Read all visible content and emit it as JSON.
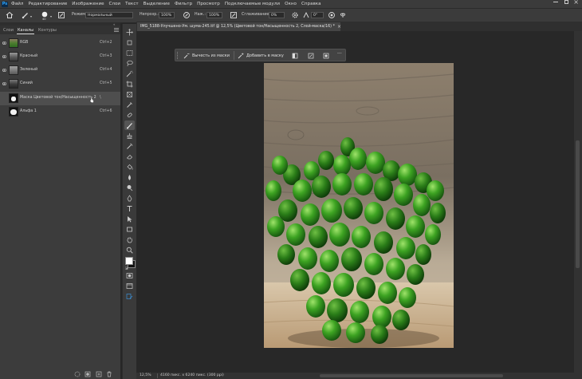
{
  "menubar": {
    "logo": "Ps",
    "items": [
      "Файл",
      "Редактирование",
      "Изображение",
      "Слои",
      "Текст",
      "Выделение",
      "Фильтр",
      "Просмотр",
      "Подключаемые модули",
      "Окно",
      "Справка"
    ]
  },
  "options": {
    "brush_size": "40",
    "mode_label": "Режим:",
    "mode_value": "Нормальный",
    "opacity_label": "Непрозр.:",
    "opacity_value": "100%",
    "flow_label": "Наж.:",
    "flow_value": "100%",
    "smoothing_label": "Сглаживание:",
    "smoothing_value": "0%",
    "angle_value": "0°"
  },
  "panel": {
    "tabs": [
      "Слои",
      "Каналы",
      "Контуры"
    ],
    "active_tab": "Каналы",
    "channels": [
      {
        "name": "RGB",
        "shortcut": "Ctrl+2",
        "visible": true,
        "thumb": "rgb"
      },
      {
        "name": "Красный",
        "shortcut": "Ctrl+3",
        "visible": true,
        "thumb": "red"
      },
      {
        "name": "Зеленый",
        "shortcut": "Ctrl+4",
        "visible": true,
        "thumb": "green"
      },
      {
        "name": "Синий",
        "shortcut": "Ctrl+5",
        "visible": true,
        "thumb": "blue"
      },
      {
        "name": "Маска Цветовой тон/Насыщенность 2",
        "shortcut": "\\",
        "visible": false,
        "thumb": "mask",
        "selected": true
      },
      {
        "name": "Альфа 1",
        "shortcut": "Ctrl+6",
        "visible": false,
        "thumb": "alpha"
      }
    ]
  },
  "document": {
    "tab_title": "IMG_5188-Улучшено-Ум. шума-245.tif @ 12,5% (Цветовой тон/Насыщенность 2, Слой-маска/16) *",
    "close_glyph": "×"
  },
  "contextbar": {
    "subtract_label": "Вычесть из маски",
    "add_label": "Добавить в маску",
    "more": "···"
  },
  "status": {
    "zoom": "12,5%",
    "doc_size": "4160 пикс. x 6240 пикс. (300 ppi)"
  },
  "colors": {
    "accent": "#31a8ff",
    "panel_bg": "#3c3c3c",
    "canvas_bg": "#282828",
    "selected_row": "#4e4e4e"
  }
}
